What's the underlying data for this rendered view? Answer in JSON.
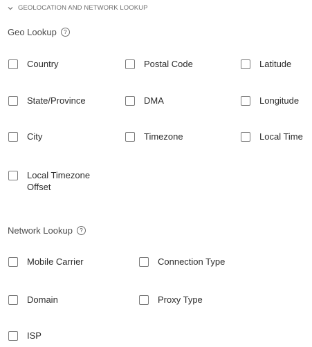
{
  "section": {
    "title": "GEOLOCATION AND NETWORK LOOKUP",
    "expanded": true
  },
  "geo": {
    "title": "Geo Lookup",
    "help_glyph": "?",
    "options": [
      {
        "label": "Country",
        "checked": false
      },
      {
        "label": "Postal Code",
        "checked": false
      },
      {
        "label": "Latitude",
        "checked": false
      },
      {
        "label": "State/Province",
        "checked": false
      },
      {
        "label": "DMA",
        "checked": false
      },
      {
        "label": "Longitude",
        "checked": false
      },
      {
        "label": "City",
        "checked": false
      },
      {
        "label": "Timezone",
        "checked": false
      },
      {
        "label": "Local Time",
        "checked": false
      },
      {
        "label": "Local Timezone Offset",
        "checked": false
      }
    ]
  },
  "network": {
    "title": "Network Lookup",
    "help_glyph": "?",
    "options": [
      {
        "label": "Mobile Carrier",
        "checked": false
      },
      {
        "label": "Connection Type",
        "checked": false
      },
      {
        "label": "Domain",
        "checked": false
      },
      {
        "label": "Proxy Type",
        "checked": false
      },
      {
        "label": "ISP",
        "checked": false
      }
    ]
  }
}
